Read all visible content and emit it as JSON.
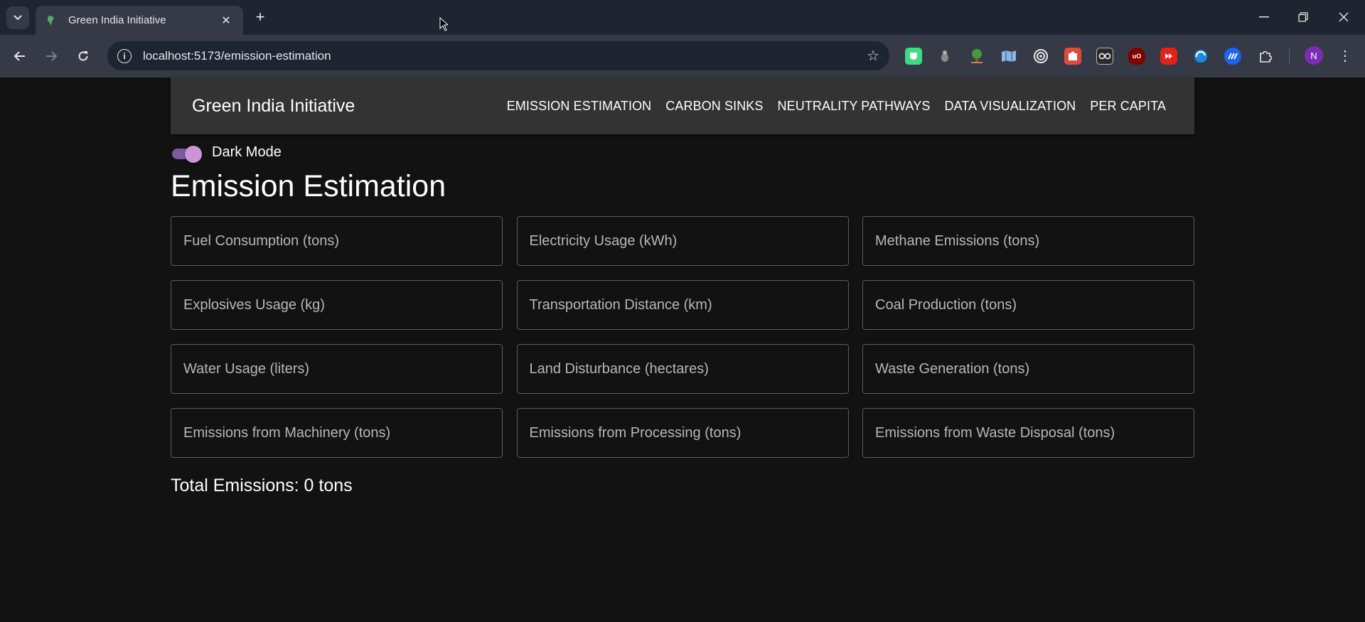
{
  "browser": {
    "tab_title": "Green India Initiative",
    "url": "localhost:5173/emission-estimation",
    "profile_initial": "N",
    "extensions": [
      "shield-ext-icon",
      "capsule-ext-icon",
      "tree-ext-icon",
      "map-ext-icon",
      "target-ext-icon",
      "puzzle-red-ext-icon",
      "glasses-ext-icon",
      "ublock-ext-icon",
      "youtube-ext-icon",
      "swirl-ext-icon",
      "speed-ext-icon",
      "extensions-puzzle-icon"
    ]
  },
  "app": {
    "brand": "Green India Initiative",
    "nav": [
      "EMISSION ESTIMATION",
      "CARBON SINKS",
      "NEUTRALITY PATHWAYS",
      "DATA VISUALIZATION",
      "PER CAPITA"
    ],
    "dark_mode_label": "Dark Mode",
    "dark_mode_on": true,
    "heading": "Emission Estimation",
    "fields": [
      {
        "placeholder": "Fuel Consumption (tons)",
        "value": ""
      },
      {
        "placeholder": "Electricity Usage (kWh)",
        "value": ""
      },
      {
        "placeholder": "Methane Emissions (tons)",
        "value": ""
      },
      {
        "placeholder": "Explosives Usage (kg)",
        "value": ""
      },
      {
        "placeholder": "Transportation Distance (km)",
        "value": ""
      },
      {
        "placeholder": "Coal Production (tons)",
        "value": ""
      },
      {
        "placeholder": "Water Usage (liters)",
        "value": ""
      },
      {
        "placeholder": "Land Disturbance (hectares)",
        "value": ""
      },
      {
        "placeholder": "Waste Generation (tons)",
        "value": ""
      },
      {
        "placeholder": "Emissions from Machinery (tons)",
        "value": ""
      },
      {
        "placeholder": "Emissions from Processing (tons)",
        "value": ""
      },
      {
        "placeholder": "Emissions from Waste Disposal (tons)",
        "value": ""
      }
    ],
    "total": "Total Emissions: 0 tons"
  },
  "colors": {
    "page_bg": "#121212",
    "appbar_bg": "#333333",
    "toggle_accent": "#ce93d8",
    "chrome_bg": "#1f2431"
  }
}
